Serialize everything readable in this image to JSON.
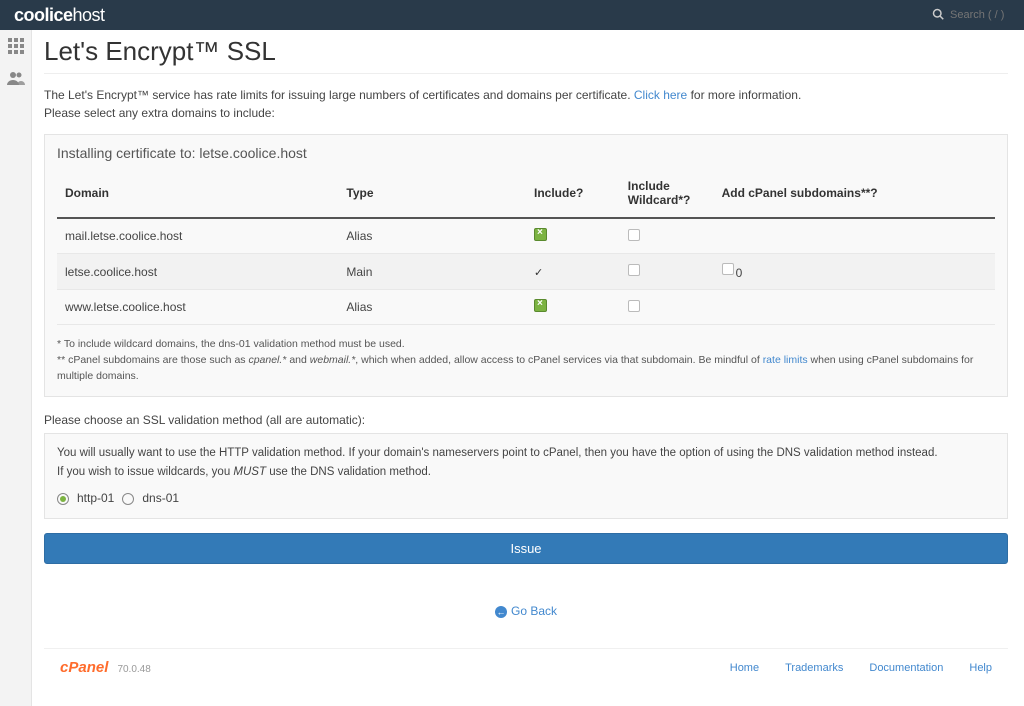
{
  "header": {
    "logo_bold": "coolice",
    "logo_light": "host",
    "search_placeholder": "Search ( / )"
  },
  "page": {
    "title": "Let's Encrypt™ SSL",
    "intro_before": "The Let's Encrypt™ service has rate limits for issuing large numbers of certificates and domains per certificate. ",
    "intro_link": "Click here",
    "intro_after": " for more information.",
    "intro_line2": "Please select any extra domains to include:"
  },
  "panel": {
    "title": "Installing certificate to: letse.coolice.host",
    "columns": {
      "domain": "Domain",
      "type": "Type",
      "include": "Include?",
      "wildcard": "Include Wildcard*?",
      "cpanel": "Add cPanel subdomains**?"
    },
    "rows": [
      {
        "domain": "mail.letse.coolice.host",
        "type": "Alias",
        "include": "green",
        "wildcard": "empty",
        "cpanel": ""
      },
      {
        "domain": "letse.coolice.host",
        "type": "Main",
        "include": "tick",
        "wildcard": "empty",
        "cpanel": "zero"
      },
      {
        "domain": "www.letse.coolice.host",
        "type": "Alias",
        "include": "green",
        "wildcard": "empty",
        "cpanel": ""
      }
    ],
    "footnote1": "* To include wildcard domains, the dns-01 validation method must be used.",
    "footnote2_before": "** cPanel subdomains are those such as ",
    "footnote2_em1": "cpanel.*",
    "footnote2_mid": " and ",
    "footnote2_em2": "webmail.*",
    "footnote2_after": ", which when added, allow access to cPanel services via that subdomain. Be mindful of ",
    "footnote2_link": "rate limits",
    "footnote2_tail": " when using cPanel subdomains for multiple domains."
  },
  "validation": {
    "heading": "Please choose an SSL validation method (all are automatic):",
    "line1": "You will usually want to use the HTTP validation method. If your domain's nameservers point to cPanel, then you have the option of using the DNS validation method instead.",
    "line2_before": "If you wish to issue wildcards, you ",
    "line2_em": "MUST",
    "line2_after": " use the DNS validation method.",
    "opt1": "http-01",
    "opt2": "dns-01"
  },
  "buttons": {
    "issue": "Issue",
    "goback": "Go Back"
  },
  "footer": {
    "brand": "cPanel",
    "version": "70.0.48",
    "links": {
      "home": "Home",
      "trademarks": "Trademarks",
      "docs": "Documentation",
      "help": "Help"
    }
  }
}
